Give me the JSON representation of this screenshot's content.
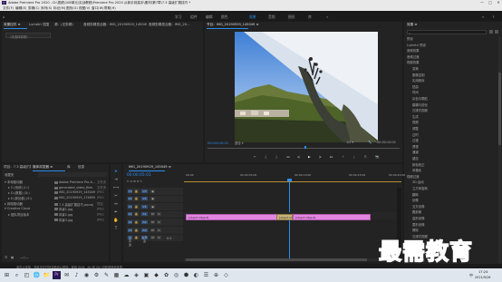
{
  "app": {
    "title": "Adobe Premiere Pro 2020 - D:\\视频\\108单元\\实战教程\\Premiere Pro 2020 从新手到高手\\素材\\第7章\\7.3 高级扩展技巧 *",
    "controls": [
      "—",
      "□",
      "✕"
    ]
  },
  "menu": [
    "文件(F)",
    "编辑(E)",
    "剪辑(C)",
    "序列(S)",
    "标记(M)",
    "图形(G)",
    "视图(V)",
    "窗口(W)",
    "帮助(H)"
  ],
  "workspaces": {
    "items": [
      "学习",
      "组件",
      "编辑",
      "颜色",
      "效果",
      "音频",
      "图形",
      "库"
    ],
    "active": "效果",
    "more": "»"
  },
  "source_panel": {
    "tabs": [
      "效果控件 ≡",
      "Lumetri 范围",
      "源：(无剪辑)",
      "音频剪辑混合器：IMG_20190929_145049.jpg",
      "音频剪辑混合器：IMG_20..."
    ],
    "empty_text": "（未选择剪辑）"
  },
  "program_monitor": {
    "tab": "节目：IMG_20190929_145049 ≡",
    "timecode": "00:00:05:01",
    "fit": "适合",
    "quality": "1/2",
    "duration": "00:00:10:00",
    "transport": [
      "⇤",
      "{",
      "}",
      "◂◂",
      "◂|",
      "▶",
      "|▸",
      "▸▸",
      "⤒",
      "⤓",
      "⎘",
      "📷"
    ]
  },
  "effects_panel": {
    "title": "效果 ≡",
    "search_placeholder": "",
    "categories": [
      "预设",
      "Lumetri 预设",
      "音频效果",
      "音频过渡",
      "视频效果",
      "变换",
      "图像控制",
      "实用程序",
      "扭曲",
      "时间",
      "杂色与颗粒",
      "模糊与锐化",
      "沉浸式视频",
      "生成",
      "视频",
      "调整",
      "过时",
      "过渡",
      "透视",
      "通道",
      "键控",
      "颜色校正",
      "风格化",
      "视频过渡",
      "3D 运动",
      "立方体旋转",
      "翻转",
      "划像",
      "交叉划像",
      "圆划像",
      "盒形划像",
      "菱形划像",
      "擦除",
      "沉浸式视频",
      "溶解",
      "内滑",
      "缩放",
      "页面剥落"
    ]
  },
  "project_panel": {
    "tabs": [
      "项目：7.3 高级扩展技巧",
      "媒体浏览器 ≡",
      "库",
      "信息"
    ],
    "breadcrumb": "收藏夹",
    "tree": [
      {
        "label": "本地驱动器",
        "expanded": true
      },
      {
        "label": "C:(系统) (C:)",
        "indent": 1
      },
      {
        "label": "D:(数据) (D:)",
        "indent": 1
      },
      {
        "label": "E:(新加卷) (E:)",
        "indent": 1
      },
      {
        "label": "网络驱动器",
        "expanded": false
      },
      {
        "label": "Creative Cloud",
        "expanded": true
      },
      {
        "label": "团队项目版本",
        "indent": 1
      }
    ],
    "files": [
      {
        "name": "Adobe Premiere Pro A...",
        "type": "文件夹"
      },
      {
        "name": "generated_video_files",
        "type": "文件夹"
      },
      {
        "name": "IMG_20190929_145049",
        "type": "JPEG"
      },
      {
        "name": "IMG_20190929_174855",
        "type": "JPEG"
      },
      {
        "name": "7.3 高级扩展技巧.prproj",
        "type": "项目"
      },
      {
        "name": "风景1.jpg",
        "type": "JPEG"
      },
      {
        "name": "风景2.jpg",
        "type": "JPEG"
      },
      {
        "name": "风景3.jpg",
        "type": "JPEG"
      }
    ]
  },
  "timeline": {
    "tab": "IMG_20190929_145049 ≡",
    "timecode": "00:00:05:01",
    "ruler": [
      "00:00",
      "00:00:05:00",
      "00:00:10:00",
      "00:00:15:00",
      "00:00:20:00"
    ],
    "tracks": [
      {
        "name": "V3",
        "label": ""
      },
      {
        "name": "V2",
        "label": ""
      },
      {
        "name": "V1",
        "label": ""
      },
      {
        "name": "A1",
        "label": ""
      },
      {
        "name": "A2",
        "label": ""
      },
      {
        "name": "A3",
        "label": ""
      },
      {
        "name": "主声道",
        "label": "0.0"
      }
    ],
    "clips": [
      {
        "label": "IMG_20190929_145049.jpg"
      },
      {
        "label": "交叉溶解"
      },
      {
        "label": "IMG_20190929_174855.jpg"
      }
    ]
  },
  "status_bar": {
    "text": "单击以选择，或单击空白处并拖动以框选。使用 Shift、Alt 和 Ctrl 可获得其他选项。"
  },
  "watermark": {
    "text": "最需教育"
  },
  "taskbar": {
    "time": "17:24",
    "date": "2021/9/26",
    "lang": "中",
    "apps": [
      "⊞",
      "⌕",
      "◰",
      "🌐",
      "📁",
      "Pr",
      "✉",
      "♪",
      "◉",
      "⚙",
      "✎",
      "▦",
      "☁",
      "◈",
      "▣",
      "◆",
      "✿",
      "◎",
      "⬢",
      "◐",
      "☰",
      "⊕",
      "◇"
    ]
  },
  "colors": {
    "accent": "#2d8ceb",
    "clip": "#e286df",
    "playhead": "#2d8ceb",
    "watermark": "#1e3fa0"
  }
}
